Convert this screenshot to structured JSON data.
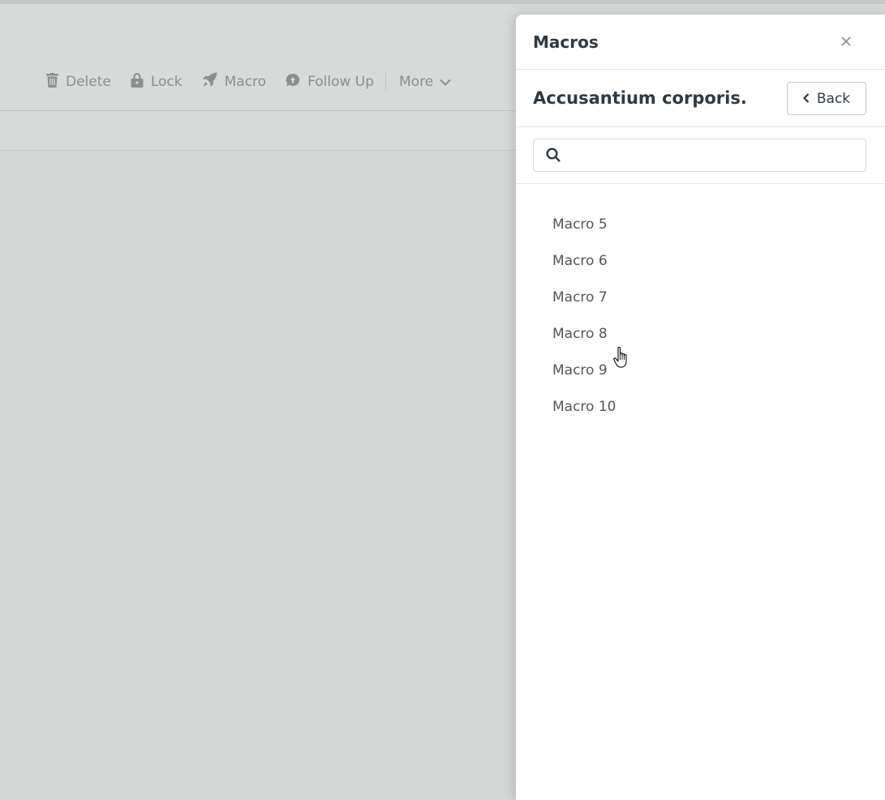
{
  "toolbar": {
    "delete_label": "Delete",
    "lock_label": "Lock",
    "macro_label": "Macro",
    "follow_up_label": "Follow Up",
    "more_label": "More"
  },
  "panel": {
    "title": "Macros",
    "category_title": "Accusantium corporis.",
    "back_label": "Back",
    "search": {
      "value": "",
      "placeholder": ""
    },
    "macros": [
      {
        "label": "Macro 5"
      },
      {
        "label": "Macro 6"
      },
      {
        "label": "Macro 7"
      },
      {
        "label": "Macro 8"
      },
      {
        "label": "Macro 9"
      },
      {
        "label": "Macro 10"
      }
    ]
  },
  "colors": {
    "overlay_gray": "#d5d7d6",
    "panel_bg": "#ffffff",
    "heading_text": "#2f3941",
    "muted_text": "#8d8f8e",
    "item_text": "#555555"
  },
  "icons": [
    "trash-icon",
    "lock-icon",
    "rocket-icon",
    "follow-up-icon",
    "chevron-down-icon",
    "close-icon",
    "chevron-left-icon",
    "search-icon",
    "hand-pointer-icon"
  ]
}
